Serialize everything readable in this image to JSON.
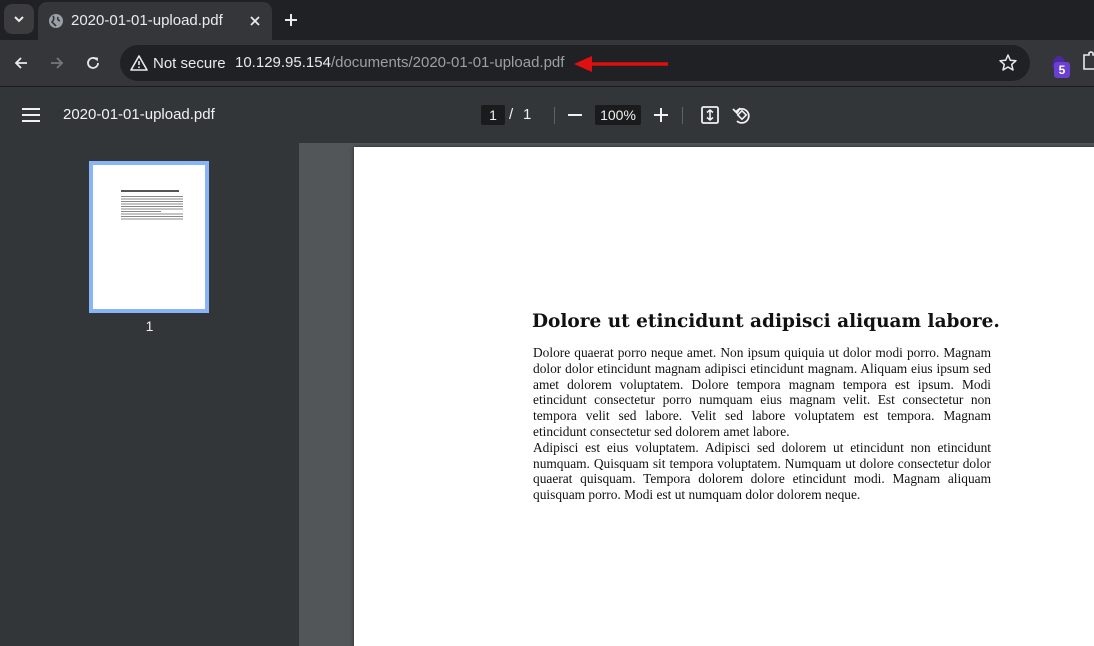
{
  "browser": {
    "tab": {
      "title": "2020-01-01-upload.pdf"
    },
    "omnibox": {
      "security_label": "Not secure",
      "url_host": "10.129.95.154",
      "url_path": "/documents/2020-01-01-upload.pdf"
    },
    "extension_badge": "5",
    "annotation_arrow_color": "#e01010"
  },
  "pdf_viewer": {
    "title": "2020-01-01-upload.pdf",
    "current_page": "1",
    "page_separator": "/",
    "total_pages": "1",
    "zoom": "100%",
    "thumbnail_label": "1"
  },
  "document": {
    "heading": "Dolore ut etincidunt adipisci aliquam labore.",
    "paragraphs": [
      "Dolore quaerat porro neque amet. Non ipsum quiquia ut dolor modi porro. Magnam dolor dolor etincidunt magnam adipisci etincidunt magnam. Aliquam eius ipsum sed amet dolorem voluptatem. Dolore tempora magnam tempora est ipsum. Modi etincidunt consectetur porro numquam eius magnam velit. Est consectetur non tempora velit sed labore. Velit sed labore voluptatem est tempora. Magnam etincidunt consectetur sed dolorem amet labore.",
      "Adipisci est eius voluptatem. Adipisci sed dolorem ut etincidunt non etincidunt numquam. Quisquam sit tempora voluptatem. Numquam ut dolore consectetur dolor quaerat quisquam. Tempora dolorem dolore etincidunt modi. Magnam aliquam quisquam porro. Modi est ut numquam dolor dolorem neque."
    ]
  }
}
